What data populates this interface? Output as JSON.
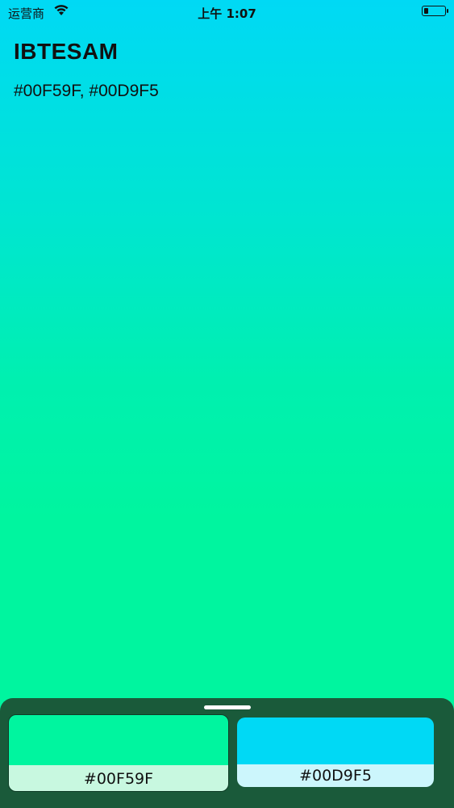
{
  "status_bar": {
    "carrier": "运营商",
    "time": "上午 1:07",
    "wifi_icon": "wifi-icon",
    "battery_icon": "battery-icon"
  },
  "palette": {
    "name": "IBTESAM",
    "codes_text": "#00F59F, #00D9F5"
  },
  "swatches": [
    {
      "hex": "#00F59F",
      "label_bg": "#C8F8E0"
    },
    {
      "hex": "#00D9F5",
      "label_bg": "#CCF6FC"
    }
  ],
  "colors": {
    "gradient_top": "#00D9F5",
    "gradient_bottom": "#00F59F",
    "sheet_bg": "#1A5A3A"
  }
}
